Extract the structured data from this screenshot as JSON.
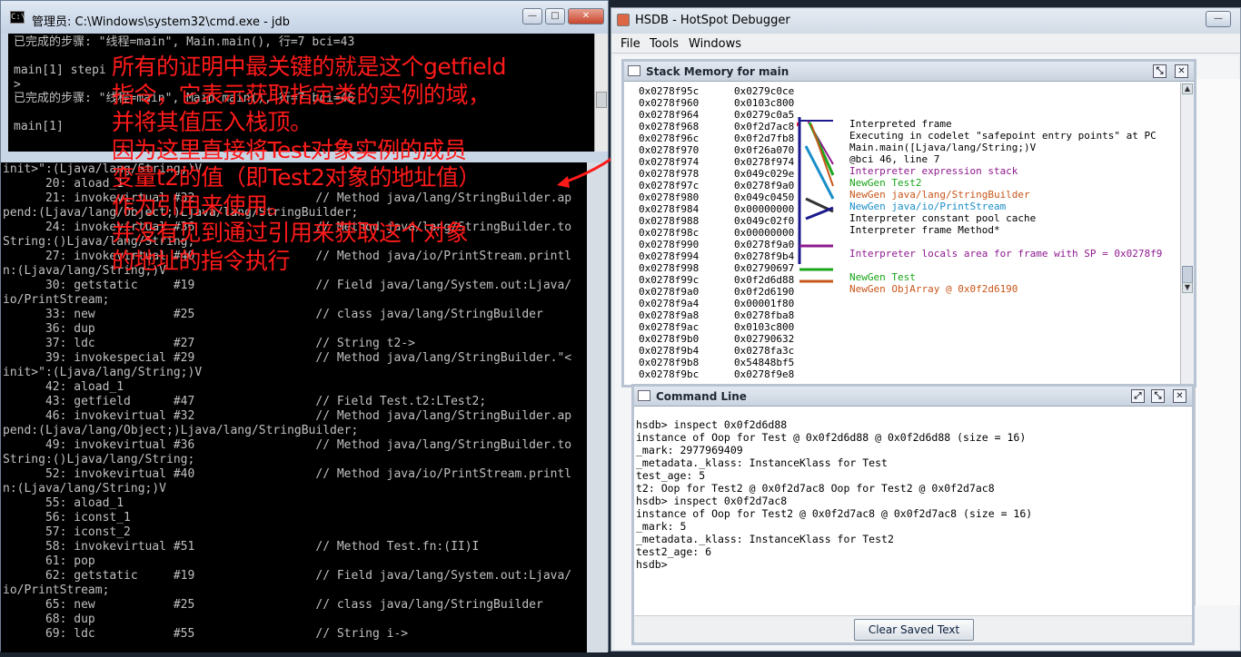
{
  "cmd_window": {
    "title": "管理员: C:\\Windows\\system32\\cmd.exe - jdb",
    "icon": "console-icon",
    "top_console": [
      "已完成的步骤: \"线程=main\", Main.main(), 行=7 bci=43",
      "",
      "main[1] stepi",
      ">",
      "已完成的步骤: \"线程=main\", Main.main(), 行=7 bci=46",
      "",
      "main[1]"
    ],
    "main_console": [
      "init>\":(Ljava/lang/String;)V",
      "      20: aload_1",
      "      21: invokevirtual #32                 // Method java/lang/StringBuilder.ap",
      "pend:(Ljava/lang/Object;)Ljava/lang/StringBuilder;",
      "      24: invokevirtual #36                 // Method java/lang/StringBuilder.to",
      "String:()Ljava/lang/String;",
      "      27: invokevirtual #40                 // Method java/io/PrintStream.printl",
      "n:(Ljava/lang/String;)V",
      "      30: getstatic     #19                 // Field java/lang/System.out:Ljava/",
      "io/PrintStream;",
      "      33: new           #25                 // class java/lang/StringBuilder",
      "      36: dup",
      "      37: ldc           #27                 // String t2->",
      "      39: invokespecial #29                 // Method java/lang/StringBuilder.\"<",
      "init>\":(Ljava/lang/String;)V",
      "      42: aload_1",
      "      43: getfield      #47                 // Field Test.t2:LTest2;",
      "      46: invokevirtual #32                 // Method java/lang/StringBuilder.ap",
      "pend:(Ljava/lang/Object;)Ljava/lang/StringBuilder;",
      "      49: invokevirtual #36                 // Method java/lang/StringBuilder.to",
      "String:()Ljava/lang/String;",
      "      52: invokevirtual #40                 // Method java/io/PrintStream.printl",
      "n:(Ljava/lang/String;)V",
      "      55: aload_1",
      "      56: iconst_1",
      "      57: iconst_2",
      "      58: invokevirtual #51                 // Method Test.fn:(II)I",
      "      61: pop",
      "      62: getstatic     #19                 // Field java/lang/System.out:Ljava/",
      "io/PrintStream;",
      "      65: new           #25                 // class java/lang/StringBuilder",
      "      68: dup",
      "      69: ldc           #55                 // String i->"
    ],
    "annotation": [
      "所有的证明中最关键的就是这个getfield",
      "指令，它表示获取指定类的实例的域，",
      "并将其值压入栈顶。",
      "因为这里直接将Test对象实例的成员",
      "变量t2的值（即Test2对象的地址值）",
      "作为引用来使用。",
      "并没有见到通过引用来获取这个对象",
      "的地址的指令执行"
    ],
    "annotation_color": "#ff1a1a"
  },
  "hsdb": {
    "title": "HSDB - HotSpot Debugger",
    "menu": [
      "File",
      "Tools",
      "Windows"
    ],
    "stack_memory": {
      "title": "Stack Memory for main",
      "addresses": [
        "0x0278f95c",
        "0x0278f960",
        "0x0278f964",
        "0x0278f968",
        "0x0278f96c",
        "0x0278f970",
        "0x0278f974",
        "0x0278f978",
        "0x0278f97c",
        "0x0278f980",
        "0x0278f984",
        "0x0278f988",
        "0x0278f98c",
        "0x0278f990",
        "0x0278f994",
        "0x0278f998",
        "0x0278f99c",
        "0x0278f9a0",
        "0x0278f9a4",
        "0x0278f9a8",
        "0x0278f9ac",
        "0x0278f9b0",
        "0x0278f9b4",
        "0x0278f9b8",
        "0x0278f9bc"
      ],
      "values": [
        "0x0279c0ce",
        "0x0103c800",
        "0x0279c0a5",
        "0x0f2d7ac8",
        "0x0f2d7fb8",
        "0x0f26a070",
        "0x0278f974",
        "0x049c029e",
        "0x0278f9a0",
        "0x049c0450",
        "0x00000000",
        "0x049c02f0",
        "0x00000000",
        "0x0278f9a0",
        "0x0278f9b4",
        "0x02790697",
        "0x0f2d6d88",
        "0x0f2d6190",
        "0x00001f80",
        "0x0278fba8",
        "0x0103c800",
        "0x02790632",
        "0x0278fa3c",
        "0x54848bf5",
        "0x0278f9e8"
      ],
      "annotations": [
        {
          "text": "Interpreted frame",
          "color": "#000000"
        },
        {
          "text": "Executing in codelet \"safepoint entry points\" at PC",
          "color": "#000000"
        },
        {
          "text": "Main.main([Ljava/lang/String;)V",
          "color": "#000000"
        },
        {
          "text": "@bci 46, line 7",
          "color": "#000000"
        },
        {
          "text": "Interpreter expression stack",
          "color": "#8e1a8e"
        },
        {
          "text": "NewGen Test2",
          "color": "#1aa51a"
        },
        {
          "text": "NewGen java/lang/StringBuilder",
          "color": "#c8561a"
        },
        {
          "text": "NewGen java/io/PrintStream",
          "color": "#1a8ec8"
        },
        {
          "text": "Interpreter constant pool cache",
          "color": "#000000"
        },
        {
          "text": "Interpreter frame Method*",
          "color": "#000000"
        },
        {
          "text": "",
          "color": "#000000"
        },
        {
          "text": "Interpreter locals area for frame with SP = 0x0278f9",
          "color": "#8e1a8e"
        },
        {
          "text": "",
          "color": "#000000"
        },
        {
          "text": "NewGen Test",
          "color": "#1aa51a"
        },
        {
          "text": "NewGen ObjArray @ 0x0f2d6190",
          "color": "#c8561a"
        }
      ]
    },
    "command_line": {
      "title": "Command Line",
      "lines": [
        "hsdb> inspect 0x0f2d6d88",
        "instance of Oop for Test @ 0x0f2d6d88 @ 0x0f2d6d88 (size = 16)",
        "_mark: 2977969409",
        "_metadata._klass: InstanceKlass for Test",
        "test_age: 5",
        "t2: Oop for Test2 @ 0x0f2d7ac8 Oop for Test2 @ 0x0f2d7ac8",
        "hsdb> inspect 0x0f2d7ac8",
        "instance of Oop for Test2 @ 0x0f2d7ac8 @ 0x0f2d7ac8 (size = 16)",
        "_mark: 5",
        "_metadata._klass: InstanceKlass for Test2",
        "test2_age: 6",
        "hsdb>"
      ],
      "clear_button": "Clear Saved Text"
    }
  }
}
